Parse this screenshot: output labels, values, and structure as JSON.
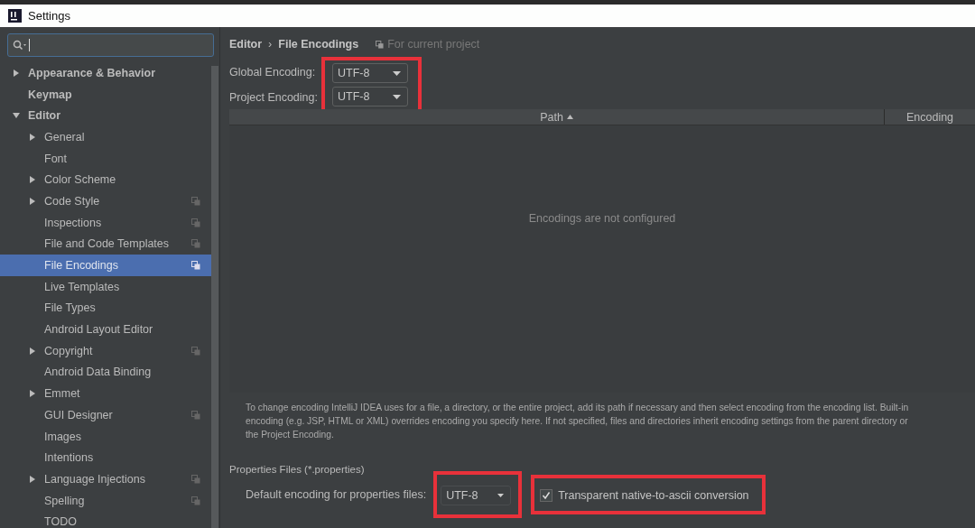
{
  "window": {
    "title": "Settings"
  },
  "tree": [
    {
      "label": "Appearance & Behavior",
      "bold": true,
      "expandable": true,
      "expanded": false,
      "selected": false,
      "project_icon": false
    },
    {
      "label": "Keymap",
      "bold": true,
      "expandable": false,
      "expanded": false,
      "selected": false,
      "project_icon": false
    },
    {
      "label": "Editor",
      "bold": true,
      "expandable": true,
      "expanded": true,
      "selected": false,
      "project_icon": false,
      "children": [
        {
          "label": "General",
          "bold": false,
          "expandable": true,
          "expanded": false,
          "selected": false,
          "project_icon": false
        },
        {
          "label": "Font",
          "bold": false,
          "expandable": false,
          "expanded": false,
          "selected": false,
          "project_icon": false
        },
        {
          "label": "Color Scheme",
          "bold": false,
          "expandable": true,
          "expanded": false,
          "selected": false,
          "project_icon": false
        },
        {
          "label": "Code Style",
          "bold": false,
          "expandable": true,
          "expanded": false,
          "selected": false,
          "project_icon": true
        },
        {
          "label": "Inspections",
          "bold": false,
          "expandable": false,
          "expanded": false,
          "selected": false,
          "project_icon": true
        },
        {
          "label": "File and Code Templates",
          "bold": false,
          "expandable": false,
          "expanded": false,
          "selected": false,
          "project_icon": true
        },
        {
          "label": "File Encodings",
          "bold": false,
          "expandable": false,
          "expanded": false,
          "selected": true,
          "project_icon": true
        },
        {
          "label": "Live Templates",
          "bold": false,
          "expandable": false,
          "expanded": false,
          "selected": false,
          "project_icon": false
        },
        {
          "label": "File Types",
          "bold": false,
          "expandable": false,
          "expanded": false,
          "selected": false,
          "project_icon": false
        },
        {
          "label": "Android Layout Editor",
          "bold": false,
          "expandable": false,
          "expanded": false,
          "selected": false,
          "project_icon": false
        },
        {
          "label": "Copyright",
          "bold": false,
          "expandable": true,
          "expanded": false,
          "selected": false,
          "project_icon": true
        },
        {
          "label": "Android Data Binding",
          "bold": false,
          "expandable": false,
          "expanded": false,
          "selected": false,
          "project_icon": false
        },
        {
          "label": "Emmet",
          "bold": false,
          "expandable": true,
          "expanded": false,
          "selected": false,
          "project_icon": false
        },
        {
          "label": "GUI Designer",
          "bold": false,
          "expandable": false,
          "expanded": false,
          "selected": false,
          "project_icon": true
        },
        {
          "label": "Images",
          "bold": false,
          "expandable": false,
          "expanded": false,
          "selected": false,
          "project_icon": false
        },
        {
          "label": "Intentions",
          "bold": false,
          "expandable": false,
          "expanded": false,
          "selected": false,
          "project_icon": false
        },
        {
          "label": "Language Injections",
          "bold": false,
          "expandable": true,
          "expanded": false,
          "selected": false,
          "project_icon": true
        },
        {
          "label": "Spelling",
          "bold": false,
          "expandable": false,
          "expanded": false,
          "selected": false,
          "project_icon": true
        },
        {
          "label": "TODO",
          "bold": false,
          "expandable": false,
          "expanded": false,
          "selected": false,
          "project_icon": false
        }
      ]
    }
  ],
  "breadcrumb": {
    "items": [
      "Editor",
      "File Encodings"
    ],
    "separator": "›",
    "scope": "For current project"
  },
  "encodings": {
    "highlighted": true,
    "fields": [
      {
        "label": "Global Encoding:",
        "value": "UTF-8"
      },
      {
        "label": "Project Encoding:",
        "value": "UTF-8"
      }
    ]
  },
  "table": {
    "columns": [
      {
        "label": "Path",
        "sorted": true
      },
      {
        "label": "Encoding",
        "sorted": false
      }
    ],
    "empty_text": "Encodings are not configured"
  },
  "info_lines": [
    "To change encoding IntelliJ IDEA uses for a file, a directory, or the entire project, add its path if necessary and then select encoding from the encoding list. Built-in",
    "encoding (e.g. JSP, HTML or XML) overrides encoding you specify here. If not specified, files and directories inherit encoding settings from the parent directory or",
    "the Project Encoding."
  ],
  "properties": {
    "heading": "Properties Files (*.properties)",
    "label": "Default encoding for properties files:",
    "value": "UTF-8",
    "value_highlighted": true,
    "checkbox": {
      "label": "Transparent native-to-ascii conversion",
      "checked": true,
      "highlighted": true
    }
  }
}
